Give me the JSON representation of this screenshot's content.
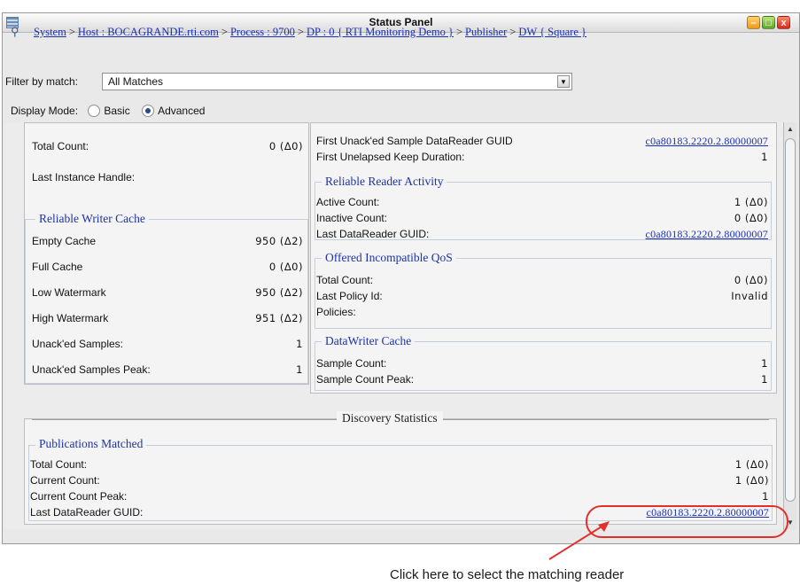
{
  "window": {
    "title": "Status Panel"
  },
  "breadcrumb": [
    {
      "label": "System"
    },
    {
      "label": "Host : BOCAGRANDE.rti.com"
    },
    {
      "label": "Process : 9700"
    },
    {
      "label": "DP : 0 { RTI Monitoring Demo }"
    },
    {
      "label": "Publisher"
    },
    {
      "label": "DW { Square }"
    }
  ],
  "breadcrumb_separator": ">",
  "filter": {
    "label": "Filter by match:",
    "value": "All Matches"
  },
  "display_mode": {
    "label": "Display Mode:",
    "options": [
      "Basic",
      "Advanced"
    ],
    "selected": "Advanced"
  },
  "left_panel": {
    "top_rows": [
      {
        "label": "Total Count:",
        "value": "0 (Δ0)"
      },
      {
        "label": "Last Instance Handle:",
        "value": ""
      }
    ],
    "reliable_writer_cache": {
      "title": "Reliable Writer Cache",
      "rows": [
        {
          "label": "Empty Cache",
          "value": "950 (Δ2)"
        },
        {
          "label": "Full Cache",
          "value": "0 (Δ0)"
        },
        {
          "label": "Low Watermark",
          "value": "950 (Δ2)"
        },
        {
          "label": "High Watermark",
          "value": "951 (Δ2)"
        },
        {
          "label": "Unack'ed Samples:",
          "value": "1"
        },
        {
          "label": "Unack'ed Samples Peak:",
          "value": "1"
        }
      ]
    }
  },
  "right_panel": {
    "top_rows": [
      {
        "label": "First Unack'ed Sample DataReader GUID",
        "link": "c0a80183.2220.2.80000007"
      },
      {
        "label": "First Unelapsed Keep Duration:",
        "value": "1"
      }
    ],
    "reliable_reader_activity": {
      "title": "Reliable Reader Activity",
      "rows": [
        {
          "label": "Active Count:",
          "value": "1 (Δ0)"
        },
        {
          "label": "Inactive Count:",
          "value": "0 (Δ0)"
        },
        {
          "label": "Last DataReader GUID:",
          "link": "c0a80183.2220.2.80000007"
        }
      ]
    },
    "offered_incompatible_qos": {
      "title": "Offered Incompatible QoS",
      "rows": [
        {
          "label": "Total Count:",
          "value": "0 (Δ0)"
        },
        {
          "label": "Last Policy Id:",
          "value": "Invalid"
        },
        {
          "label": "Policies:",
          "value": ""
        }
      ]
    },
    "datawriter_cache": {
      "title": "DataWriter Cache",
      "rows": [
        {
          "label": "Sample Count:",
          "value": "1"
        },
        {
          "label": "Sample Count Peak:",
          "value": "1"
        }
      ]
    }
  },
  "discovery": {
    "title": "Discovery Statistics",
    "publications_matched": {
      "title": "Publications Matched",
      "rows": [
        {
          "label": "Total Count:",
          "value": "1 (Δ0)"
        },
        {
          "label": "Current Count:",
          "value": "1 (Δ0)"
        },
        {
          "label": "Current Count Peak:",
          "value": "1"
        },
        {
          "label": "Last DataReader GUID:",
          "link": "c0a80183.2220.2.80000007"
        }
      ]
    }
  },
  "annotation": {
    "text": "Click here to select the matching reader"
  },
  "colors": {
    "link": "#1a2fb5",
    "group_title": "#1d33a6",
    "highlight": "#e3302a"
  },
  "icons": {
    "app": "panel-grid-icon",
    "pin": "pin-icon",
    "dropdown": "chevron-down-icon"
  }
}
